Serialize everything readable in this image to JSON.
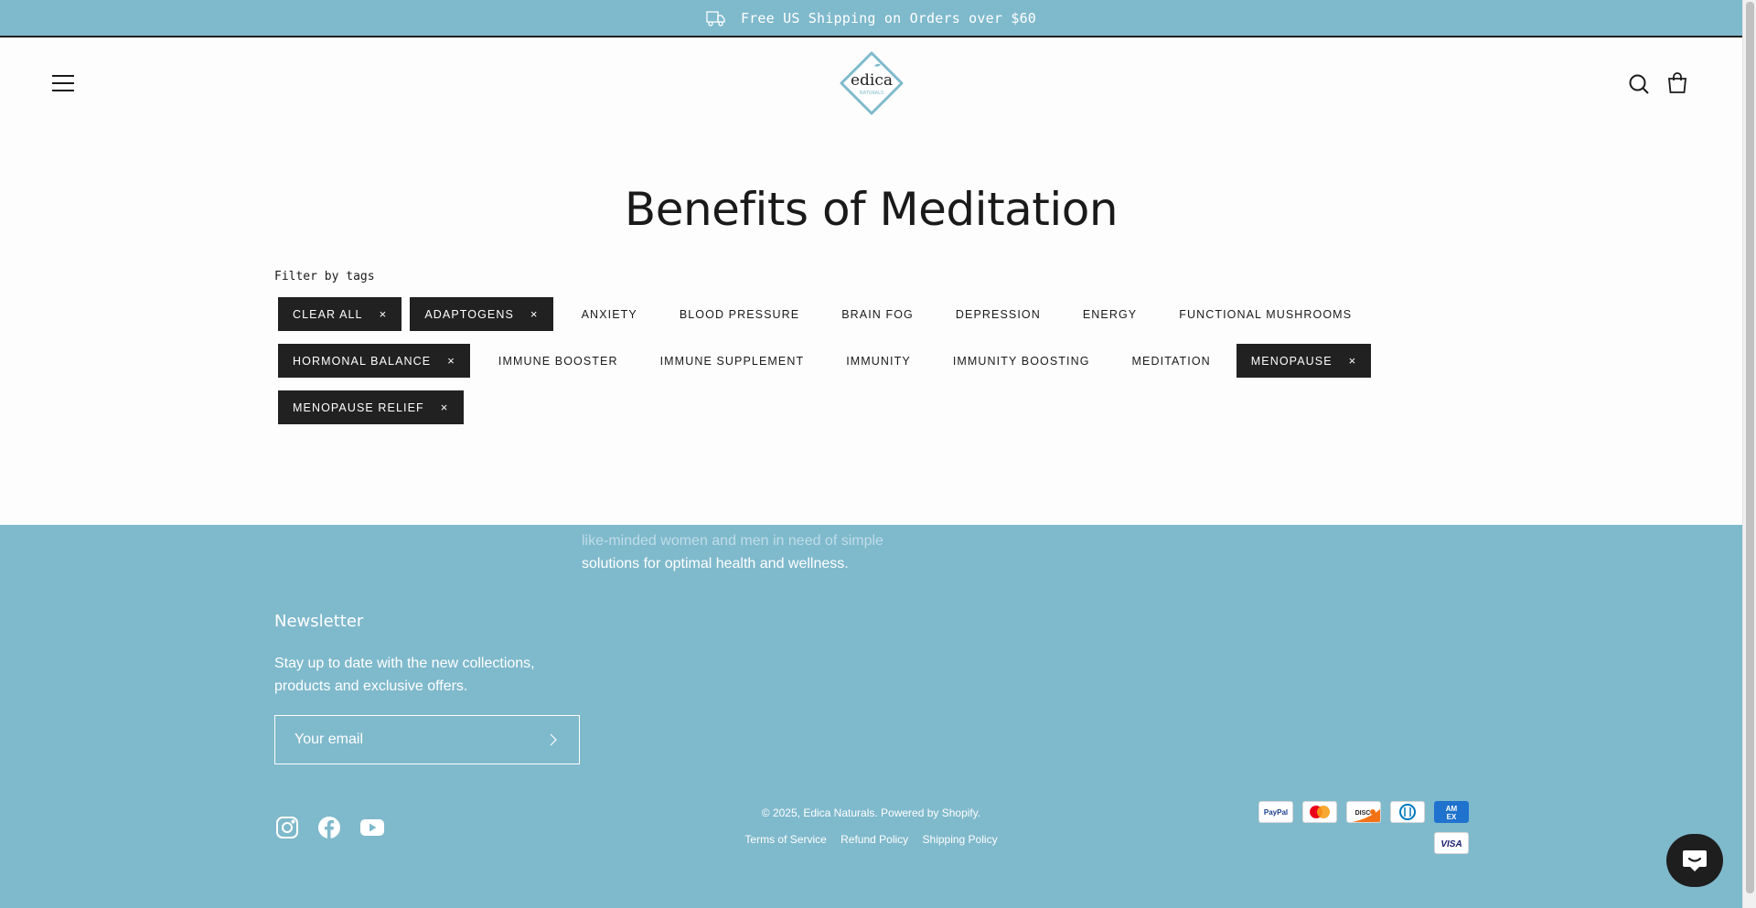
{
  "announcement": {
    "text": "Free US Shipping on Orders over $60",
    "icon": "truck-icon"
  },
  "header": {
    "menu_icon": "hamburger-icon",
    "logo_text": "edica",
    "logo_subtext": "NATURALS",
    "search_icon": "search-icon",
    "cart_icon": "bag-icon"
  },
  "page": {
    "title": "Benefits of Meditation",
    "filter_label": "Filter by tags"
  },
  "tags": {
    "row1": [
      {
        "label": "CLEAR ALL",
        "active": true
      },
      {
        "label": "ADAPTOGENS",
        "active": true
      },
      {
        "label": "ANXIETY",
        "active": false
      },
      {
        "label": "BLOOD PRESSURE",
        "active": false
      },
      {
        "label": "BRAIN FOG",
        "active": false
      },
      {
        "label": "DEPRESSION",
        "active": false
      },
      {
        "label": "ENERGY",
        "active": false
      },
      {
        "label": "FUNCTIONAL MUSHROOMS",
        "active": false
      }
    ],
    "row2": [
      {
        "label": "HORMONAL BALANCE",
        "active": true
      },
      {
        "label": "IMMUNE BOOSTER",
        "active": false
      },
      {
        "label": "IMMUNE SUPPLEMENT",
        "active": false
      },
      {
        "label": "IMMUNITY",
        "active": false
      },
      {
        "label": "IMMUNITY BOOSTING",
        "active": false
      },
      {
        "label": "MEDITATION",
        "active": false
      },
      {
        "label": "MENOPAUSE",
        "active": true
      }
    ],
    "row3": [
      {
        "label": "MENOPAUSE RELIEF",
        "active": true
      }
    ],
    "remove_glyph": "×"
  },
  "footer": {
    "about_line1": "like-minded women and men in need of simple",
    "about_line2": "solutions for optimal health and wellness.",
    "newsletter_title": "Newsletter",
    "newsletter_text": "Stay up to date with the new collections, products and exclusive offers.",
    "email_placeholder": "Your email",
    "copyright": "© 2025, Edica Naturals. Powered by Shopify.",
    "policies": [
      "Terms of Service",
      "Refund Policy",
      "Shipping Policy"
    ],
    "social": [
      "instagram-icon",
      "facebook-icon",
      "youtube-icon"
    ],
    "payments": [
      "PayPal",
      "Mastercard",
      "Discover",
      "Diners Club",
      "American Express",
      "Visa"
    ]
  },
  "colors": {
    "accent": "#7fb9cc",
    "dark": "#212121",
    "white": "#ffffff"
  }
}
